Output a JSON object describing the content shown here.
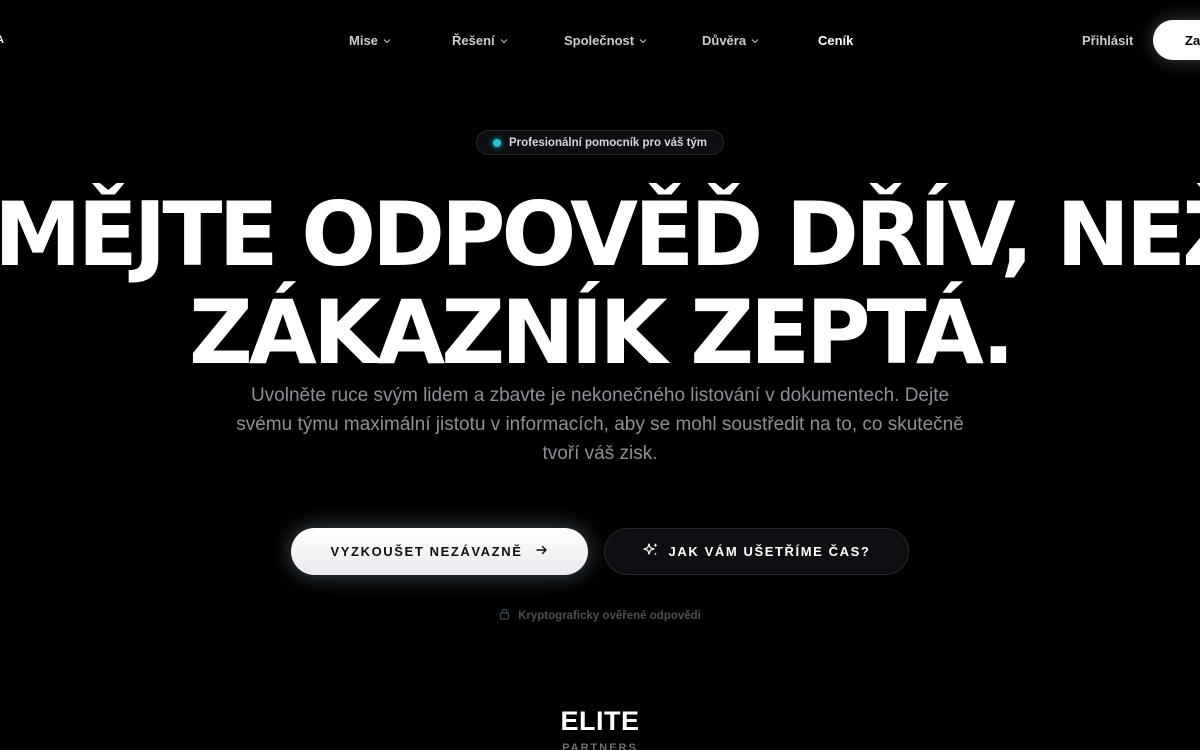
{
  "header": {
    "logo_fragment": "A",
    "nav": [
      {
        "label": "Mise",
        "has_dropdown": true
      },
      {
        "label": "Řešení",
        "has_dropdown": true
      },
      {
        "label": "Společnost",
        "has_dropdown": true
      },
      {
        "label": "Důvěra",
        "has_dropdown": true
      },
      {
        "label": "Ceník",
        "has_dropdown": false
      }
    ],
    "login_label": "Přihlásit",
    "cta_label": "Za"
  },
  "hero": {
    "badge": "Profesionální pomocník pro váš tým",
    "badge_dot_color": "#22c5d8",
    "headline_line1": "MĚJTE ODPOVĚĎ DŘÍV, NEŽ SE",
    "headline_line2": "ZÁKAZNÍK ZEPTÁ.",
    "subtitle": "Uvolněte ruce svým lidem a zbavte je nekonečného listování v dokumentech. Dejte svému týmu maximální jistotu v informacích, aby se mohl soustředit na to, co skutečně tvoří váš zisk.",
    "primary_cta": "VYZKOUŠET NEZÁVAZNĚ",
    "primary_cta_icon": "arrow-right-icon",
    "secondary_cta": "JAK VÁM UŠETŘÍME ČAS?",
    "secondary_cta_icon": "sparkles-icon",
    "verified_note": "Kryptograficky ověřené odpovědi",
    "verified_icon": "lock-icon"
  },
  "next_section": {
    "title": "ELITE",
    "subtitle_fragment": "PARTNERS"
  }
}
